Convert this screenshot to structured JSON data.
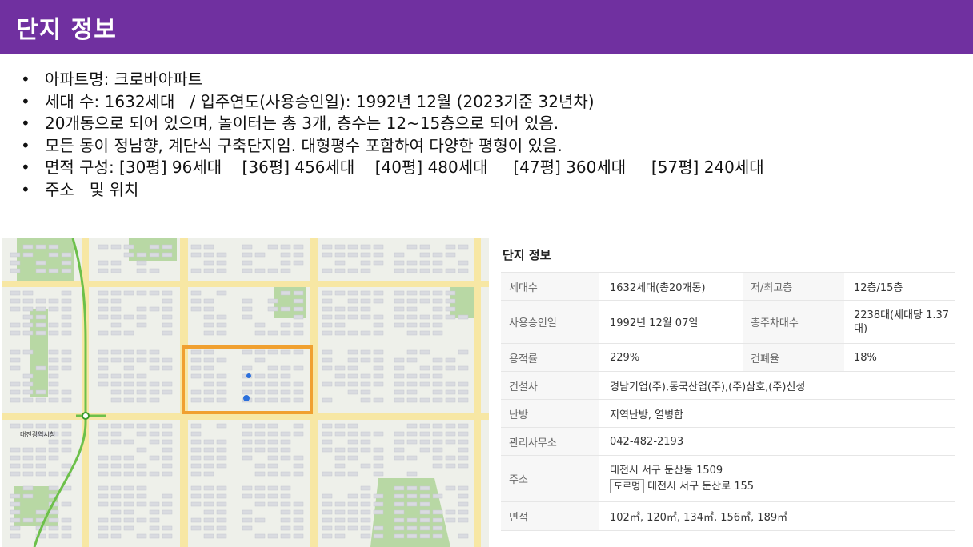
{
  "header": {
    "title": "단지 정보"
  },
  "bullets": [
    "아파트명: 크로바아파트",
    "세대 수: 1632세대   / 입주연도(사용승인일): 1992년 12월 (2023기준 32년차)",
    "20개동으로 되어 있으며, 놀이터는 총 3개, 층수는 12~15층으로 되어 있음.",
    "모든 동이 정남향, 계단식 구축단지임. 대형평수 포함하여 다양한 평형이 있음.",
    "면적 구성: [30평] 96세대    [36평] 456세대    [40평] 480세대     [47평] 360세대     [57평] 240세대",
    "주소   및 위치"
  ],
  "map": {
    "station_label": "대전광역시청",
    "highlight_color": "#f0a030"
  },
  "info": {
    "title": "단지 정보",
    "rows": [
      {
        "label": "세대수",
        "value": "1632세대(총20개동)",
        "label2": "저/최고층",
        "value2": "12층/15층"
      },
      {
        "label": "사용승인일",
        "value": "1992년 12월 07일",
        "label2": "총주차대수",
        "value2": "2238대(세대당 1.37대)"
      },
      {
        "label": "용적률",
        "value": "229%",
        "label2": "건폐율",
        "value2": "18%"
      },
      {
        "label": "건설사",
        "value": "경남기업(주),동국산업(주),(주)삼호,(주)신성"
      },
      {
        "label": "난방",
        "value": "지역난방, 열병합"
      },
      {
        "label": "관리사무소",
        "value": "042-482-2193"
      },
      {
        "label": "주소",
        "value": "대전시 서구 둔산동 1509",
        "tag": "도로명",
        "road": "대전시 서구 둔산로 155"
      },
      {
        "label": "면적",
        "value": "102㎡, 120㎡, 134㎡, 156㎡, 189㎡"
      }
    ]
  }
}
